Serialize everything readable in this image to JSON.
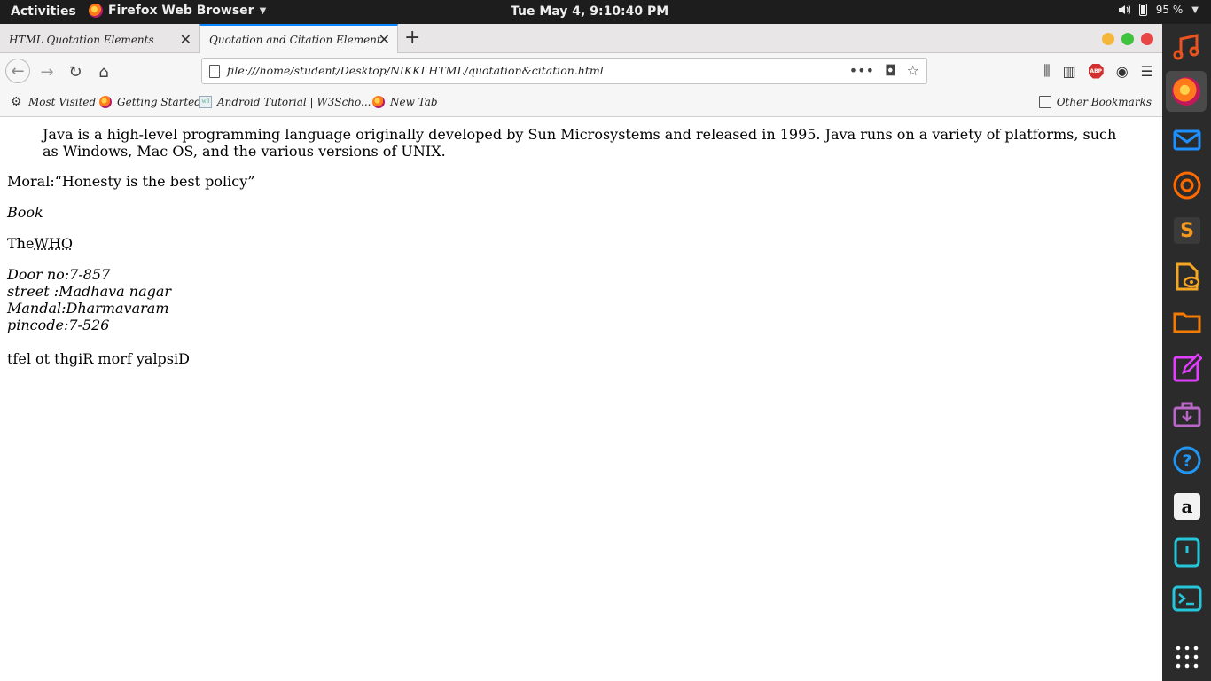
{
  "top_bar": {
    "activities": "Activities",
    "app_menu": "Firefox Web Browser",
    "clock": "Tue May  4,  9:10:40 PM",
    "battery_percent": "95 %"
  },
  "browser": {
    "tabs": [
      {
        "label": "HTML Quotation Elements",
        "active": false
      },
      {
        "label": "Quotation and Citation Element",
        "active": true
      }
    ],
    "url": "file:///home/student/Desktop/NIKKI HTML/quotation&citation.html",
    "bookmarks": [
      {
        "label": "Most Visited",
        "icon": "gear-icon"
      },
      {
        "label": "Getting Started",
        "icon": "firefox-icon"
      },
      {
        "label": "Android Tutorial | W3Scho...",
        "icon": "w3schools-icon"
      },
      {
        "label": "New Tab",
        "icon": "firefox-icon"
      }
    ],
    "other_bookmarks": "Other Bookmarks"
  },
  "page": {
    "blockquote": "Java is a high-level programming language originally developed by Sun Microsystems and released in 1995. Java runs on a variety of platforms, such as Windows, Mac OS, and the various versions of UNIX.",
    "moral_prefix": "Moral:",
    "moral_quote": "“Honesty is the best policy”",
    "cite": "Book",
    "abbr_prefix": "The",
    "abbr_word": "WHO",
    "address_lines": [
      "Door no:7-857",
      "street :Madhava nagar",
      "Mandal:Dharmavaram",
      "pincode:7-526"
    ],
    "bdo": "tfel ot thgiR morf yalpsiD"
  },
  "dock": [
    {
      "icon": "rhythmbox-icon",
      "color": "#e95420"
    },
    {
      "icon": "firefox-icon",
      "color": "#ff9500"
    },
    {
      "icon": "thunderbird-icon",
      "color": "#1e90ff"
    },
    {
      "icon": "shotwell-icon",
      "color": "#ff6a00"
    },
    {
      "icon": "sublime-text-icon",
      "color": "#f79a1d"
    },
    {
      "icon": "document-viewer-icon",
      "color": "#f5a623"
    },
    {
      "icon": "files-icon",
      "color": "#f57c00"
    },
    {
      "icon": "text-editor-icon",
      "color": "#e040fb"
    },
    {
      "icon": "software-icon",
      "color": "#ba68c8"
    },
    {
      "icon": "help-icon",
      "color": "#2196f3"
    },
    {
      "icon": "amazon-icon",
      "color": "#ff9900"
    },
    {
      "icon": "mouse-icon",
      "color": "#26c6da"
    },
    {
      "icon": "terminal-icon",
      "color": "#26c6da"
    },
    {
      "icon": "show-applications-icon",
      "color": "#ffffff"
    }
  ]
}
